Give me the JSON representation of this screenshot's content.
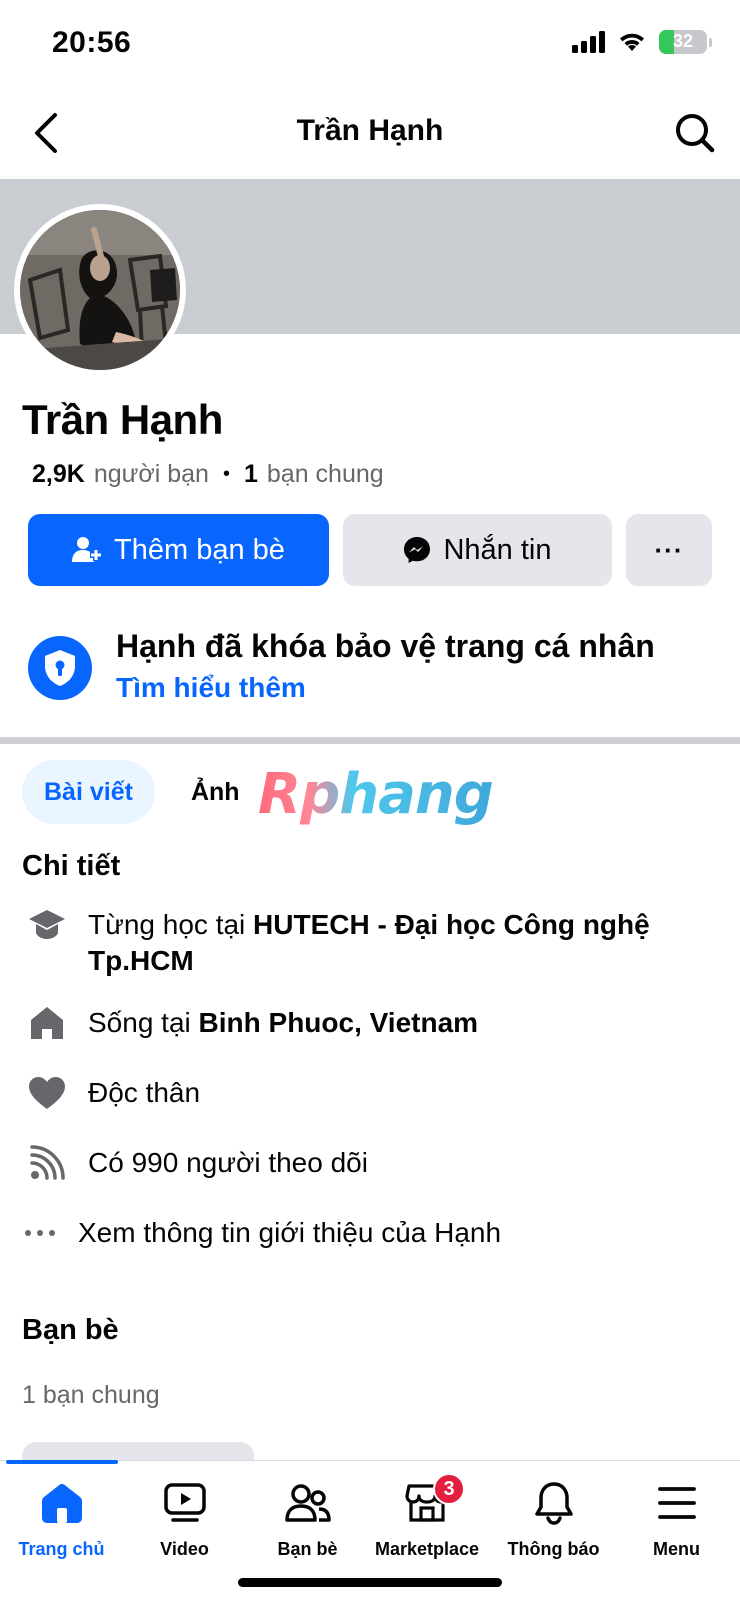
{
  "status_bar": {
    "time": "20:56",
    "battery": "32",
    "battery_level": 0.32
  },
  "header": {
    "title": "Trần Hạnh"
  },
  "profile": {
    "name": "Trần Hạnh",
    "friends_count": "2,9K",
    "friends_label": "người bạn",
    "mutual_count": "1",
    "mutual_label": "bạn chung"
  },
  "actions": {
    "add_friend": "Thêm bạn bè",
    "message": "Nhắn tin",
    "more": "···"
  },
  "lock_notice": {
    "title": "Hạnh đã khóa bảo vệ trang cá nhân",
    "link": "Tìm hiểu thêm"
  },
  "tabs": [
    {
      "label": "Bài viết",
      "active": true
    },
    {
      "label": "Ảnh",
      "active": false
    }
  ],
  "watermark": "Rphang",
  "details": {
    "title": "Chi tiết",
    "items": [
      {
        "icon": "graduation-cap-icon",
        "prefix": "Từng học tại ",
        "bold": "HUTECH - Đại học Công nghệ Tp.HCM"
      },
      {
        "icon": "home-icon",
        "prefix": "Sống tại ",
        "bold": "Binh Phuoc, Vietnam"
      },
      {
        "icon": "heart-icon",
        "prefix": "Độc thân",
        "bold": ""
      },
      {
        "icon": "rss-icon",
        "prefix": "Có 990 người theo dõi",
        "bold": ""
      },
      {
        "icon": "more-dots-icon",
        "prefix": "Xem thông tin giới thiệu của Hạnh",
        "bold": ""
      }
    ]
  },
  "friends": {
    "title": "Bạn bè",
    "subtitle": "1 bạn chung"
  },
  "bottom_nav": [
    {
      "label": "Trang chủ",
      "icon": "home-icon",
      "active": true
    },
    {
      "label": "Video",
      "icon": "video-icon",
      "active": false
    },
    {
      "label": "Bạn bè",
      "icon": "friends-icon",
      "active": false
    },
    {
      "label": "Marketplace",
      "icon": "marketplace-icon",
      "active": false,
      "badge": "3"
    },
    {
      "label": "Thông báo",
      "icon": "bell-icon",
      "active": false
    },
    {
      "label": "Menu",
      "icon": "menu-icon",
      "active": false
    }
  ],
  "colors": {
    "accent": "#0866ff",
    "secondary_button": "#e4e6eb",
    "cover": "#c9ccd1",
    "badge": "#e41e3f",
    "battery": "#34c759"
  }
}
